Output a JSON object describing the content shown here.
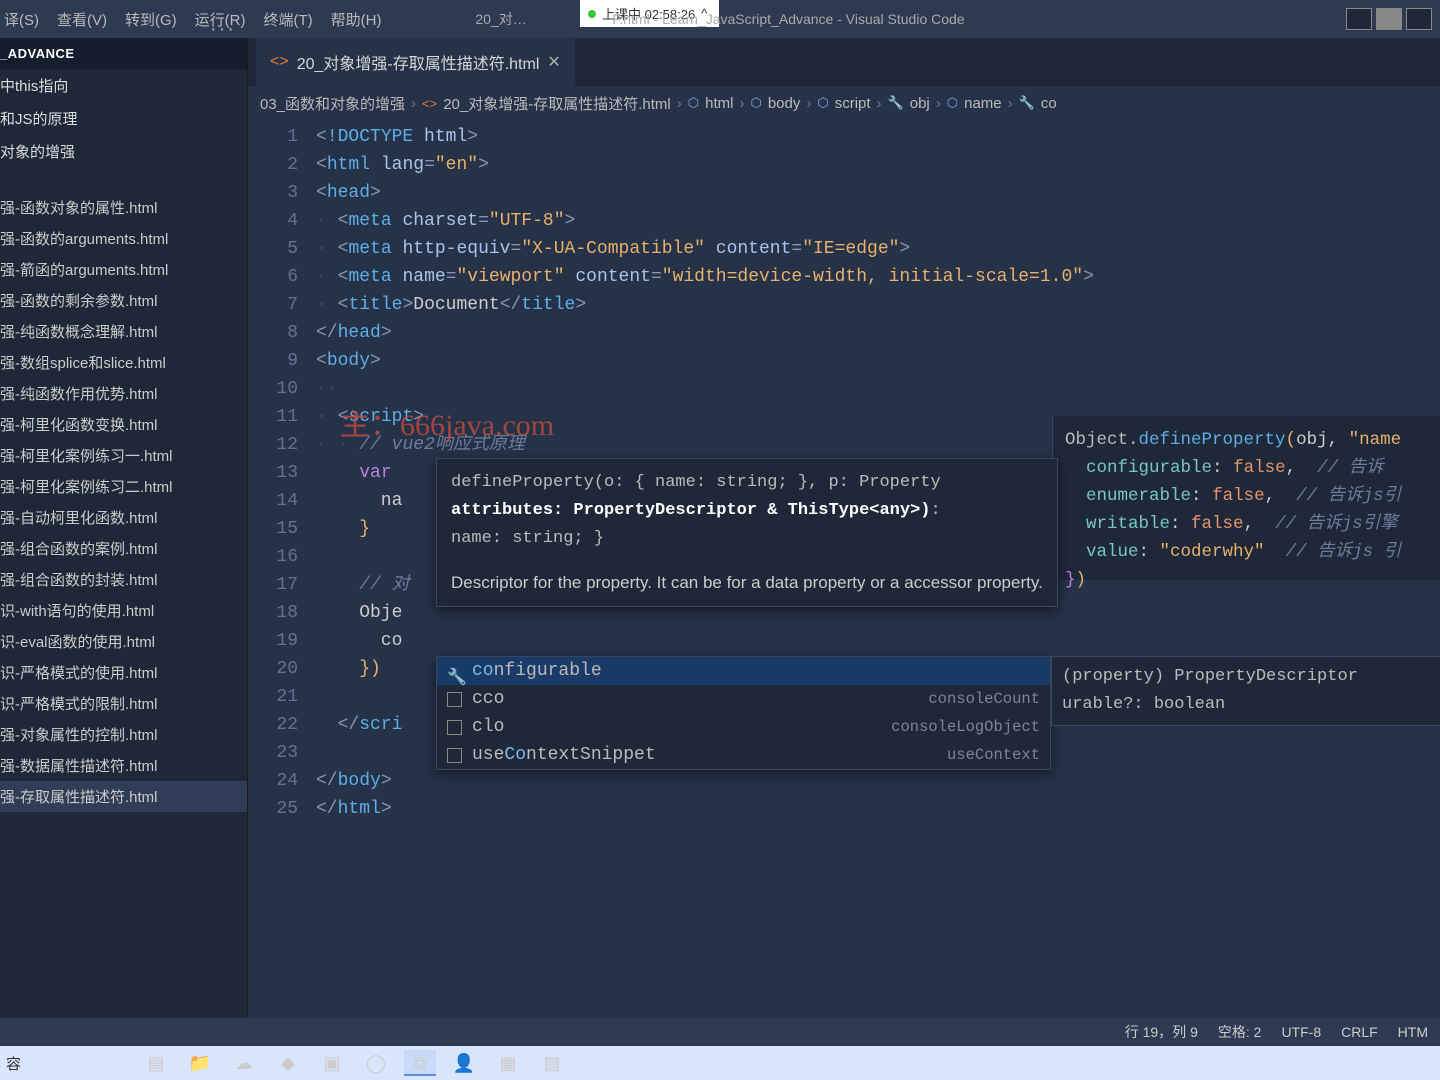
{
  "titlebar": {
    "menu": [
      "译(S)",
      "查看(V)",
      "转到(G)",
      "运行(R)",
      "终端(T)",
      "帮助(H)"
    ],
    "title_prefix": "20_对…",
    "title_suffix": "F.html - Learn_JavaScript_Advance - Visual Studio Code",
    "recording": {
      "dot": "●",
      "label": "上课中 02:58:26",
      "caret": "^"
    }
  },
  "sidebar": {
    "root": "_ADVANCE",
    "folders": [
      "中this指向",
      "和JS的原理",
      "对象的增强"
    ],
    "files": [
      "强-函数对象的属性.html",
      "强-函数的arguments.html",
      "强-箭函的arguments.html",
      "强-函数的剩余参数.html",
      "强-纯函数概念理解.html",
      "强-数组splice和slice.html",
      "强-纯函数作用优势.html",
      "强-柯里化函数变换.html",
      "强-柯里化案例练习一.html",
      "强-柯里化案例练习二.html",
      "强-自动柯里化函数.html",
      "强-组合函数的案例.html",
      "强-组合函数的封装.html",
      "识-with语句的使用.html",
      "识-eval函数的使用.html",
      "识-严格模式的使用.html",
      "识-严格模式的限制.html",
      "强-对象属性的控制.html",
      "强-数据属性描述符.html",
      "强-存取属性描述符.html"
    ],
    "active_index": 19
  },
  "tab": {
    "filename": "20_对象增强-存取属性描述符.html",
    "dots": "···"
  },
  "breadcrumb": {
    "parts": [
      "03_函数和对象的增强",
      "20_对象增强-存取属性描述符.html",
      "html",
      "body",
      "script",
      "obj",
      "name",
      "co"
    ]
  },
  "code": {
    "lines": [
      {
        "n": 1,
        "h": "<span class='tk-ang'>&lt;</span><span class='tk-doctype'>!DOCTYPE</span> <span class='tk-attr'>html</span><span class='tk-ang'>&gt;</span>"
      },
      {
        "n": 2,
        "h": "<span class='tk-ang'>&lt;</span><span class='tk-tag'>html</span> <span class='tk-attr'>lang</span><span class='tk-ang'>=</span><span class='tk-str'>\"en\"</span><span class='tk-ang'>&gt;</span>"
      },
      {
        "n": 3,
        "h": "<span class='tk-ang'>&lt;</span><span class='tk-tag'>head</span><span class='tk-ang'>&gt;</span>"
      },
      {
        "n": 4,
        "h": "<span class='tk-guide'>·</span> <span class='tk-ang'>&lt;</span><span class='tk-tag'>meta</span> <span class='tk-attr'>charset</span><span class='tk-ang'>=</span><span class='tk-str'>\"UTF-8\"</span><span class='tk-ang'>&gt;</span>"
      },
      {
        "n": 5,
        "h": "<span class='tk-guide'>·</span> <span class='tk-ang'>&lt;</span><span class='tk-tag'>meta</span> <span class='tk-attr'>http-equiv</span><span class='tk-ang'>=</span><span class='tk-str'>\"X-UA-Compatible\"</span> <span class='tk-attr'>content</span><span class='tk-ang'>=</span><span class='tk-str'>\"IE=edge\"</span><span class='tk-ang'>&gt;</span>"
      },
      {
        "n": 6,
        "h": "<span class='tk-guide'>·</span> <span class='tk-ang'>&lt;</span><span class='tk-tag'>meta</span> <span class='tk-attr'>name</span><span class='tk-ang'>=</span><span class='tk-str'>\"viewport\"</span> <span class='tk-attr'>content</span><span class='tk-ang'>=</span><span class='tk-str'>\"width=device-width, initial-scale=1.0\"</span><span class='tk-ang'>&gt;</span>"
      },
      {
        "n": 7,
        "h": "<span class='tk-guide'>·</span> <span class='tk-ang'>&lt;</span><span class='tk-tag'>title</span><span class='tk-ang'>&gt;</span>Document<span class='tk-ang'>&lt;/</span><span class='tk-tag'>title</span><span class='tk-ang'>&gt;</span>"
      },
      {
        "n": 8,
        "h": "<span class='tk-ang'>&lt;/</span><span class='tk-tag'>head</span><span class='tk-ang'>&gt;</span>"
      },
      {
        "n": 9,
        "h": "<span class='tk-ang'>&lt;</span><span class='tk-tag'>body</span><span class='tk-ang'>&gt;</span>"
      },
      {
        "n": 10,
        "h": "<span class='tk-guide'>··</span>"
      },
      {
        "n": 11,
        "h": "<span class='tk-guide'>·</span> <span class='tk-ang'>&lt;</span><span class='tk-tag'>script</span><span class='tk-ang'>&gt;</span>"
      },
      {
        "n": 12,
        "h": "<span class='tk-guide'>·</span> <span class='tk-guide'>·</span> <span class='tk-comment'>// vue2响应式原理</span>"
      },
      {
        "n": 13,
        "h": "    <span class='tk-kw'>var</span> "
      },
      {
        "n": 14,
        "h": "      na"
      },
      {
        "n": 15,
        "h": "    <span style='color:#e8b06b'>}</span>"
      },
      {
        "n": 16,
        "h": ""
      },
      {
        "n": 17,
        "h": "    <span class='tk-comment'>// 对</span>"
      },
      {
        "n": 18,
        "h": "    Obje"
      },
      {
        "n": 19,
        "h": "      co"
      },
      {
        "n": 20,
        "h": "    <span style='color:#e8b06b'>}</span><span style='color:#e8b06b'>)</span>"
      },
      {
        "n": 21,
        "h": ""
      },
      {
        "n": 22,
        "h": "  <span class='tk-ang'>&lt;/</span><span class='tk-tag'>scri</span>"
      },
      {
        "n": 23,
        "h": ""
      },
      {
        "n": 24,
        "h": "<span class='tk-ang'>&lt;/</span><span class='tk-tag'>body</span><span class='tk-ang'>&gt;</span>"
      },
      {
        "n": 25,
        "h": "<span class='tk-ang'>&lt;/</span><span class='tk-tag'>html</span><span class='tk-ang'>&gt;</span>"
      }
    ]
  },
  "param_hint": {
    "line1": "defineProperty(o: { name: string; }, p: Property",
    "line2_pre": "attributes: PropertyDescriptor & ThisType<any>)",
    "line2_post": ":",
    "line3": "name: string; }",
    "desc": "Descriptor for the property. It can be for a data property or a accessor property."
  },
  "suggest": {
    "items": [
      {
        "icon": "wrench",
        "label": "configurable",
        "hl": "co",
        "rest": "nfigurable",
        "alias": ""
      },
      {
        "icon": "box",
        "label": "cco",
        "hl": "",
        "rest": "cco",
        "alias": "consoleCount"
      },
      {
        "icon": "box",
        "label": "clo",
        "hl": "",
        "rest": "clo",
        "alias": "consoleLogObject"
      },
      {
        "icon": "box",
        "label": "useContextSnippet",
        "hl": "",
        "rest": "useContextSnippet",
        "alias": "useContext"
      }
    ],
    "doc": "(property) PropertyDescriptor\nurable?: boolean"
  },
  "side_panel": {
    "l1": "Object.defineProperty(obj, \"name",
    "l2": "  configurable: false,  // 告诉",
    "l3": "  enumerable: false,  // 告诉js引",
    "l4": "  writable: false,  // 告诉js引擎",
    "l5": "  value: \"coderwhy\"  // 告诉js 引",
    "l6": "})"
  },
  "statusbar": {
    "pos": "行 19，列 9",
    "spaces": "空格: 2",
    "enc": "UTF-8",
    "eol": "CRLF",
    "lang": "HTM"
  },
  "taskbar": {
    "icons": [
      "▤",
      "📁",
      "☁",
      "◆",
      "▣",
      "◯",
      "⧉",
      "👤",
      "▦",
      "▧"
    ],
    "input_label": "容"
  },
  "watermark": "主：666java.com"
}
